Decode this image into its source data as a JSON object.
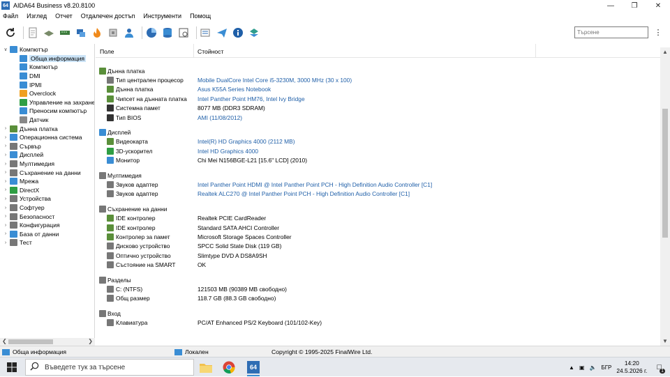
{
  "window": {
    "title": "AIDA64 Business v8.20.8100",
    "app_icon_text": "64"
  },
  "menu": [
    "Файл",
    "Изглед",
    "Отчет",
    "Отдалечен достъп",
    "Инструменти",
    "Помощ"
  ],
  "search": {
    "placeholder": "Търсене"
  },
  "columns": {
    "field": "Поле",
    "value": "Стойност"
  },
  "tree": [
    {
      "label": "Компютър",
      "level": 0,
      "expanded": true,
      "icon": "computer-icon",
      "color": "#3a8dd4"
    },
    {
      "label": "Обща информация",
      "level": 1,
      "selected": true,
      "icon": "computer-icon",
      "color": "#3a8dd4"
    },
    {
      "label": "Компютър",
      "level": 1,
      "icon": "computer-icon",
      "color": "#3a8dd4"
    },
    {
      "label": "DMI",
      "level": 1,
      "icon": "dmi-icon",
      "color": "#3a8dd4"
    },
    {
      "label": "IPMI",
      "level": 1,
      "icon": "ipmi-icon",
      "color": "#3a8dd4"
    },
    {
      "label": "Overclock",
      "level": 1,
      "icon": "flame-icon",
      "color": "#f0a020"
    },
    {
      "label": "Управление на захранe",
      "level": 1,
      "icon": "power-icon",
      "color": "#2f9e44"
    },
    {
      "label": "Преносим компютър",
      "level": 1,
      "icon": "laptop-icon",
      "color": "#3a8dd4"
    },
    {
      "label": "Датчик",
      "level": 1,
      "icon": "sensor-icon",
      "color": "#888888"
    },
    {
      "label": "Дънна платка",
      "level": 0,
      "icon": "motherboard-icon",
      "color": "#5a8f3a"
    },
    {
      "label": "Операционна система",
      "level": 0,
      "icon": "windows-icon",
      "color": "#3a8dd4"
    },
    {
      "label": "Сървър",
      "level": 0,
      "icon": "server-icon",
      "color": "#777777"
    },
    {
      "label": "Дисплей",
      "level": 0,
      "icon": "display-icon",
      "color": "#3a8dd4"
    },
    {
      "label": "Мултимедия",
      "level": 0,
      "icon": "speaker-icon",
      "color": "#777777"
    },
    {
      "label": "Съхранение на данни",
      "level": 0,
      "icon": "storage-icon",
      "color": "#777777"
    },
    {
      "label": "Мрежа",
      "level": 0,
      "icon": "network-icon",
      "color": "#3a8dd4"
    },
    {
      "label": "DirectX",
      "level": 0,
      "icon": "directx-icon",
      "color": "#2f9e44"
    },
    {
      "label": "Устройства",
      "level": 0,
      "icon": "devices-icon",
      "color": "#777777"
    },
    {
      "label": "Софтуер",
      "level": 0,
      "icon": "software-icon",
      "color": "#777777"
    },
    {
      "label": "Безопасност",
      "level": 0,
      "icon": "security-icon",
      "color": "#777777"
    },
    {
      "label": "Конфигурация",
      "level": 0,
      "icon": "config-icon",
      "color": "#777777"
    },
    {
      "label": "База от данни",
      "level": 0,
      "icon": "database-icon",
      "color": "#3a8dd4"
    },
    {
      "label": "Тест",
      "level": 0,
      "icon": "test-icon",
      "color": "#777777"
    }
  ],
  "rows": [
    {
      "type": "group",
      "field": "Дънна платка",
      "color": "#5a8f3a"
    },
    {
      "field": "Тип централен процесор",
      "value": "Mobile DualCore Intel Core i5-3230M, 3000 MHz (30 x 100)",
      "link": true,
      "color": "#777777"
    },
    {
      "field": "Дънна платка",
      "value": "Asus K55A Series Notebook",
      "link": true,
      "color": "#5a8f3a"
    },
    {
      "field": "Чипсет на дънната платка",
      "value": "Intel Panther Point HM76, Intel Ivy Bridge",
      "link": true,
      "color": "#5a8f3a"
    },
    {
      "field": "Системна памет",
      "value": "8077 MB  (DDR3 SDRAM)",
      "link": false,
      "color": "#333333"
    },
    {
      "field": "Тип BIOS",
      "value": "AMI (11/08/2012)",
      "link": true,
      "color": "#333333"
    },
    {
      "type": "spacer"
    },
    {
      "type": "group",
      "field": "Дисплей",
      "color": "#3a8dd4"
    },
    {
      "field": "Видеокарта",
      "value": "Intel(R) HD Graphics 4000  (2112 MB)",
      "link": true,
      "color": "#5a8f3a"
    },
    {
      "field": "3D-ускорител",
      "value": "Intel HD Graphics 4000",
      "link": true,
      "color": "#2f9e44"
    },
    {
      "field": "Монитор",
      "value": "Chi Mei N156BGE-L21  [15.6\" LCD]  (2010)",
      "link": false,
      "color": "#3a8dd4"
    },
    {
      "type": "spacer"
    },
    {
      "type": "group",
      "field": "Мултимедия",
      "color": "#777777"
    },
    {
      "field": "Звуков адаптер",
      "value": "Intel Panther Point HDMI @ Intel Panther Point PCH - High Definition Audio Controller [C1]",
      "link": true,
      "color": "#777777"
    },
    {
      "field": "Звуков адаптер",
      "value": "Realtek ALC270 @ Intel Panther Point PCH - High Definition Audio Controller [C1]",
      "link": true,
      "color": "#777777"
    },
    {
      "type": "spacer"
    },
    {
      "type": "group",
      "field": "Съхранение на данни",
      "color": "#777777"
    },
    {
      "field": "IDE контролер",
      "value": "Realtek PCIE CardReader",
      "link": false,
      "color": "#5a8f3a"
    },
    {
      "field": "IDE контролер",
      "value": "Standard SATA AHCI Controller",
      "link": false,
      "color": "#5a8f3a"
    },
    {
      "field": "Контролер за памет",
      "value": "Microsoft Storage Spaces Controller",
      "link": false,
      "color": "#5a8f3a"
    },
    {
      "field": "Дисково устройство",
      "value": "SPCC Solid State Disk  (119 GB)",
      "link": false,
      "color": "#777777"
    },
    {
      "field": "Оптично устройство",
      "value": "Slimtype DVD A  DS8A9SH",
      "link": false,
      "color": "#777777"
    },
    {
      "field": "Състояние на SMART",
      "value": "OK",
      "link": false,
      "color": "#777777"
    },
    {
      "type": "spacer"
    },
    {
      "type": "group",
      "field": "Разделы",
      "color": "#777777"
    },
    {
      "field": "C: (NTFS)",
      "value": "121503 MB (90389 MB свободно)",
      "link": false,
      "color": "#777777"
    },
    {
      "field": "Общ размер",
      "value": "118.7 GB (88.3 GB свободно)",
      "link": false,
      "color": "#777777"
    },
    {
      "type": "spacer"
    },
    {
      "type": "group",
      "field": "Вход",
      "color": "#777777"
    },
    {
      "field": "Клавиатура",
      "value": "PC/AT Enhanced PS/2 Keyboard (101/102-Key)",
      "link": false,
      "color": "#777777"
    }
  ],
  "status": {
    "left": "Обща информация",
    "middle": "Локален",
    "right": "Copyright © 1995-2025 FinalWire Ltd."
  },
  "taskbar": {
    "search_placeholder": "Въведете тук за търсене",
    "app_label": "64",
    "lang": "БГР",
    "time": "14:20",
    "date": "24.5.2026 г.",
    "notif_count": "1"
  }
}
